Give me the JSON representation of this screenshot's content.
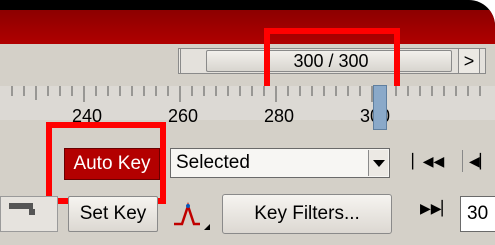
{
  "time_slider": {
    "prev_label": "<",
    "next_label": ">",
    "frame_display": "300 / 300"
  },
  "ruler": {
    "ticks": [
      "240",
      "260",
      "280",
      "300"
    ]
  },
  "controls": {
    "auto_key_label": "Auto Key",
    "key_mode_value": "Selected",
    "set_key_label": "Set Key",
    "key_filters_label": "Key Filters...",
    "frame_field_value": "30"
  },
  "colors": {
    "auto_key_active": "#b30000",
    "highlight": "#ff0000",
    "panel": "#d4d0c8"
  },
  "icons": [
    "go-to-start-icon",
    "previous-frame-icon",
    "key-mode-toggle-icon",
    "curve-editor-icon"
  ]
}
